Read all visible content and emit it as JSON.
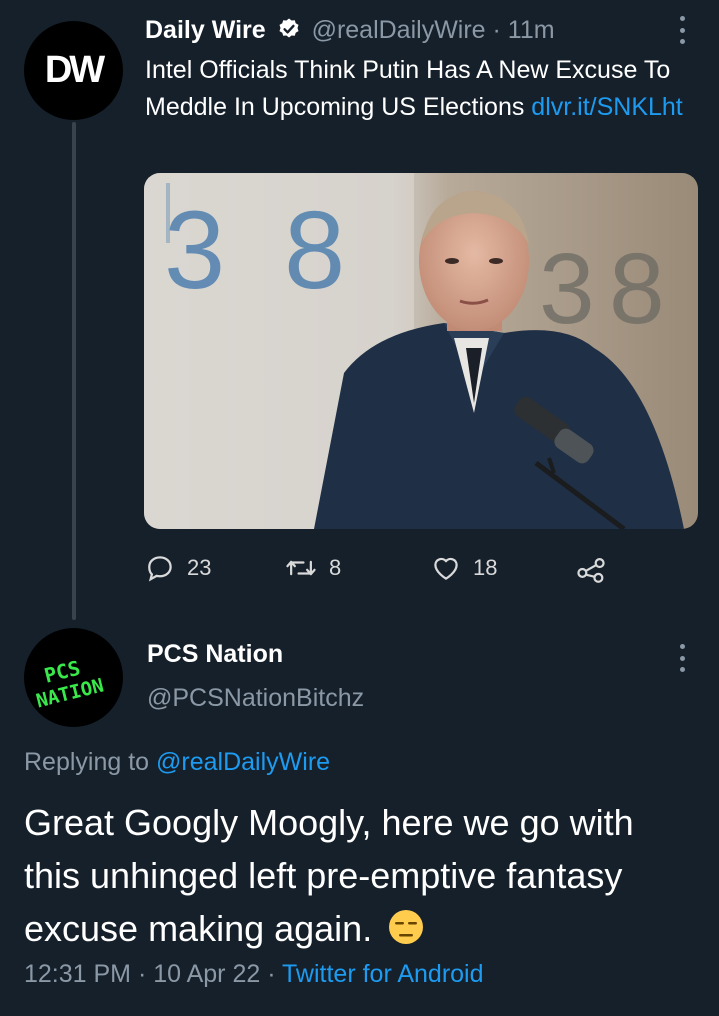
{
  "tweet1": {
    "avatar_text": "DW",
    "name": "Daily Wire",
    "handle": "@realDailyWire",
    "separator": " · ",
    "time": "11m",
    "text": "Intel Officials Think Putin Has A New Excuse To Meddle In Upcoming US Elections ",
    "link": "dlvr.it/SNKLht",
    "replies": "23",
    "retweets": "8",
    "likes": "18"
  },
  "tweet2": {
    "avatar_text": "PCS NATION",
    "name": "PCS Nation",
    "handle": "@PCSNationBitchz",
    "replying_prefix": "Replying to ",
    "replying_handle": "@realDailyWire",
    "text": "Great Googly Moogly, here we go with this unhinged left pre-emptive fantasy excuse making again.",
    "time": "12:31 PM",
    "date_sep": " · ",
    "date": "10 Apr 22",
    "source": "Twitter for Android"
  },
  "colors": {
    "background": "#15202b",
    "link": "#1d9bf0",
    "muted": "#8b98a5",
    "pcs_green": "#39e84a"
  }
}
